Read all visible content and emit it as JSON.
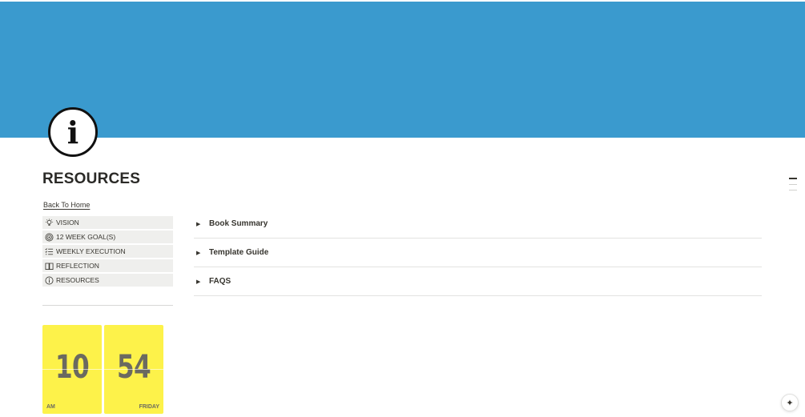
{
  "page": {
    "cover_color": "#3a9ace",
    "icon": "info-circle-icon",
    "icon_glyph": "i",
    "title": "RESOURCES",
    "back_link": "Back To Home"
  },
  "nav": {
    "items": [
      {
        "label": "VISION",
        "icon": "lightbulb-icon"
      },
      {
        "label": "12 WEEK GOAL(S)",
        "icon": "target-icon"
      },
      {
        "label": "WEEKLY EXECUTION",
        "icon": "checklist-icon"
      },
      {
        "label": "REFLECTION",
        "icon": "book-icon"
      },
      {
        "label": "RESOURCES",
        "icon": "info-icon"
      }
    ]
  },
  "toggles": [
    {
      "label": "Book Summary",
      "icon": "triangle-right-icon",
      "glyph": "▶"
    },
    {
      "label": "Template Guide",
      "icon": "triangle-right-icon",
      "glyph": "▶"
    },
    {
      "label": "FAQS",
      "icon": "triangle-right-icon",
      "glyph": "▶"
    }
  ],
  "clock": {
    "hours": "10",
    "minutes": "54",
    "period": "AM",
    "day": "FRIDAY",
    "color": "#fdf24a"
  },
  "assistant": {
    "icon": "sparkle-icon",
    "glyph": "✦"
  }
}
